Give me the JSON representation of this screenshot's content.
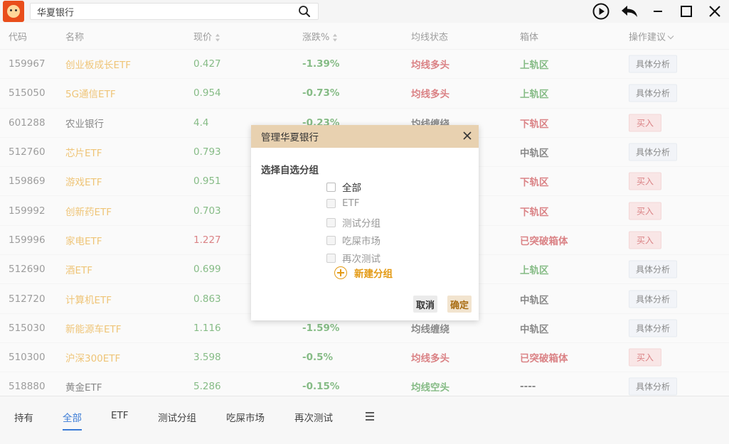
{
  "search": {
    "value": "华夏银行"
  },
  "window": {
    "play_icon": "play-circle-icon",
    "back_icon": "undo-arrow-icon",
    "minimize_icon": "minimize-icon",
    "maximize_icon": "maximize-icon",
    "close_icon": "close-icon"
  },
  "table": {
    "headers": {
      "code": "代码",
      "name": "名称",
      "price": "现价",
      "change": "涨跌%",
      "ma": "均线状态",
      "box": "箱体",
      "action": "操作建议"
    },
    "rows": [
      {
        "code": "159967",
        "name": "创业板成长ETF",
        "name_color": "#e39a14",
        "price": "0.427",
        "price_color": "#2d8a2d",
        "change": "-1.39%",
        "change_color": "#2d8a2d",
        "ma": "均线多头",
        "ma_color": "#c0282d",
        "box": "上轨区",
        "box_color": "#2d8a2d",
        "action": "具体分析",
        "action_type": "a"
      },
      {
        "code": "515050",
        "name": "5G通信ETF",
        "name_color": "#e39a14",
        "price": "0.954",
        "price_color": "#2d8a2d",
        "change": "-0.73%",
        "change_color": "#2d8a2d",
        "ma": "均线多头",
        "ma_color": "#c0282d",
        "box": "上轨区",
        "box_color": "#2d8a2d",
        "action": "具体分析",
        "action_type": "a"
      },
      {
        "code": "601288",
        "name": "农业银行",
        "name_color": "#333333",
        "price": "4.4",
        "price_color": "#2d8a2d",
        "change": "-0.23%",
        "change_color": "#2d8a2d",
        "ma": "均线缠绕",
        "ma_color": "#333333",
        "box": "下轨区",
        "box_color": "#c0282d",
        "action": "买入",
        "action_type": "b"
      },
      {
        "code": "512760",
        "name": "芯片ETF",
        "name_color": "#e39a14",
        "price": "0.793",
        "price_color": "#2d8a2d",
        "change": "",
        "change_color": "#2d8a2d",
        "ma": "",
        "ma_color": "#333333",
        "box": "中轨区",
        "box_color": "#333333",
        "action": "具体分析",
        "action_type": "a"
      },
      {
        "code": "159869",
        "name": "游戏ETF",
        "name_color": "#e39a14",
        "price": "0.951",
        "price_color": "#2d8a2d",
        "change": "",
        "change_color": "#2d8a2d",
        "ma": "",
        "ma_color": "#333333",
        "box": "下轨区",
        "box_color": "#c0282d",
        "action": "买入",
        "action_type": "b"
      },
      {
        "code": "159992",
        "name": "创新药ETF",
        "name_color": "#e39a14",
        "price": "0.703",
        "price_color": "#2d8a2d",
        "change": "",
        "change_color": "#2d8a2d",
        "ma": "",
        "ma_color": "#333333",
        "box": "下轨区",
        "box_color": "#c0282d",
        "action": "买入",
        "action_type": "b"
      },
      {
        "code": "159996",
        "name": "家电ETF",
        "name_color": "#e39a14",
        "price": "1.227",
        "price_color": "#c0282d",
        "change": "",
        "change_color": "#c0282d",
        "ma": "",
        "ma_color": "#333333",
        "box": "已突破箱体",
        "box_color": "#c0282d",
        "action": "买入",
        "action_type": "b"
      },
      {
        "code": "512690",
        "name": "酒ETF",
        "name_color": "#e39a14",
        "price": "0.699",
        "price_color": "#2d8a2d",
        "change": "",
        "change_color": "#2d8a2d",
        "ma": "",
        "ma_color": "#333333",
        "box": "上轨区",
        "box_color": "#2d8a2d",
        "action": "具体分析",
        "action_type": "a"
      },
      {
        "code": "512720",
        "name": "计算机ETF",
        "name_color": "#e39a14",
        "price": "0.863",
        "price_color": "#2d8a2d",
        "change": "",
        "change_color": "#2d8a2d",
        "ma": "",
        "ma_color": "#333333",
        "box": "中轨区",
        "box_color": "#333333",
        "action": "具体分析",
        "action_type": "a"
      },
      {
        "code": "515030",
        "name": "新能源车ETF",
        "name_color": "#e39a14",
        "price": "1.116",
        "price_color": "#2d8a2d",
        "change": "-1.59%",
        "change_color": "#2d8a2d",
        "ma": "均线缠绕",
        "ma_color": "#333333",
        "box": "中轨区",
        "box_color": "#333333",
        "action": "具体分析",
        "action_type": "a"
      },
      {
        "code": "510300",
        "name": "沪深300ETF",
        "name_color": "#e39a14",
        "price": "3.598",
        "price_color": "#2d8a2d",
        "change": "-0.5%",
        "change_color": "#2d8a2d",
        "ma": "均线多头",
        "ma_color": "#c0282d",
        "box": "已突破箱体",
        "box_color": "#c0282d",
        "action": "买入",
        "action_type": "b"
      },
      {
        "code": "518880",
        "name": "黄金ETF",
        "name_color": "#333333",
        "price": "5.286",
        "price_color": "#2d8a2d",
        "change": "-0.15%",
        "change_color": "#2d8a2d",
        "ma": "均线空头",
        "ma_color": "#2d8a2d",
        "box": "----",
        "box_color": "#333333",
        "action": "具体分析",
        "action_type": "a"
      }
    ]
  },
  "tabs": [
    {
      "label": "持有",
      "active": false
    },
    {
      "label": "全部",
      "active": true
    },
    {
      "label": "ETF",
      "active": false
    },
    {
      "label": "测试分组",
      "active": false
    },
    {
      "label": "吃屎市场",
      "active": false
    },
    {
      "label": "再次测试",
      "active": false
    }
  ],
  "tabs_menu_icon": "hamburger-menu-icon",
  "modal": {
    "title": "管理华夏银行",
    "section_label": "选择自选分组",
    "options": [
      {
        "label": "全部",
        "enabled": true
      },
      {
        "label": "ETF",
        "enabled": false
      },
      {
        "label": "测试分组",
        "enabled": false
      },
      {
        "label": "吃屎市场",
        "enabled": false
      },
      {
        "label": "再次测试",
        "enabled": false
      }
    ],
    "new_group_label": "新建分组",
    "cancel_label": "取消",
    "ok_label": "确定"
  }
}
